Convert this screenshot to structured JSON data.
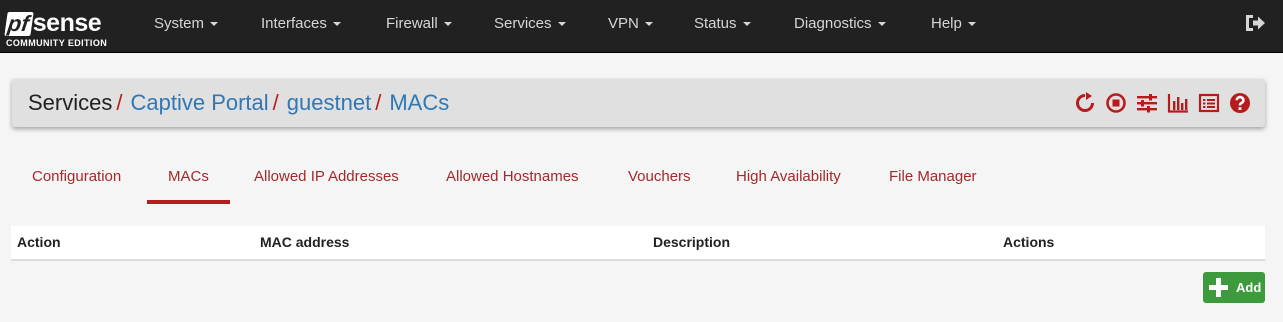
{
  "logo": {
    "prefix": "pf",
    "name": "sense",
    "edition": "COMMUNITY EDITION"
  },
  "nav": {
    "items": [
      "System",
      "Interfaces",
      "Firewall",
      "Services",
      "VPN",
      "Status",
      "Diagnostics",
      "Help"
    ],
    "logout_icon": "sign-out-icon"
  },
  "breadcrumb": {
    "items": [
      "Services",
      "Captive Portal",
      "guestnet",
      "MACs"
    ],
    "separator": "/",
    "icons": [
      "restart-icon",
      "stop-icon",
      "settings-sliders-icon",
      "bar-chart-icon",
      "list-log-icon",
      "help-circle-icon"
    ]
  },
  "tabs": {
    "items": [
      "Configuration",
      "MACs",
      "Allowed IP Addresses",
      "Allowed Hostnames",
      "Vouchers",
      "High Availability",
      "File Manager"
    ],
    "active": "MACs"
  },
  "table": {
    "headers": [
      "Action",
      "MAC address",
      "Description",
      "Actions"
    ],
    "rows": []
  },
  "add_button": {
    "label": "Add",
    "icon": "plus-icon"
  },
  "colors": {
    "navbar_bg": "#212121",
    "accent_red": "#b71c1c",
    "link_blue": "#3177b5",
    "tab_text": "#a12a2a",
    "add_green": "#3d9a3d"
  }
}
